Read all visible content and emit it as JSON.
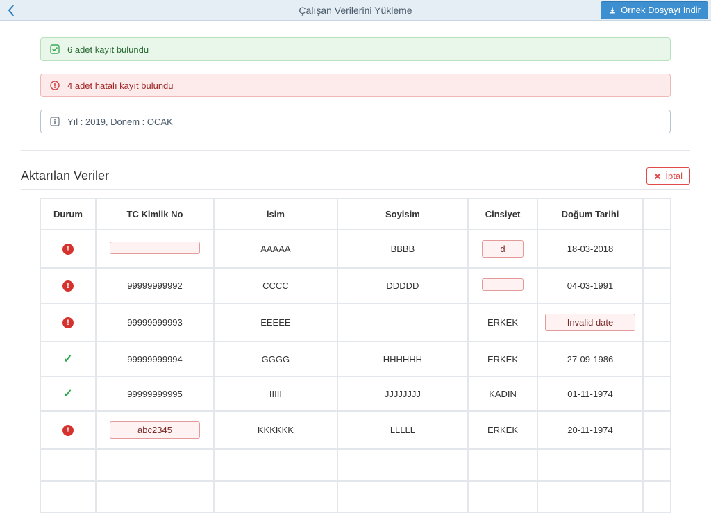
{
  "header": {
    "title": "Çalışan Verilerini Yükleme",
    "download_label": "Örnek Dosyayı İndir"
  },
  "alerts": {
    "success_text": "6 adet kayıt bulundu",
    "error_text": "4 adet hatalı kayıt bulundu",
    "info_text": "Yıl : 2019, Dönem : OCAK"
  },
  "section": {
    "title": "Aktarılan Veriler",
    "cancel_label": "İptal"
  },
  "table": {
    "headers": {
      "status": "Durum",
      "tckn": "TC Kimlik No",
      "name": "İsim",
      "surname": "Soyisim",
      "gender": "Cinsiyet",
      "dob": "Doğum Tarihi"
    },
    "rows": [
      {
        "status": "error",
        "tckn": "",
        "tckn_invalid": true,
        "name": "AAAAA",
        "surname": "BBBB",
        "gender": "d",
        "gender_invalid": true,
        "dob": "18-03-2018",
        "dob_invalid": false
      },
      {
        "status": "error",
        "tckn": "99999999992",
        "tckn_invalid": false,
        "name": "CCCC",
        "surname": "DDDDD",
        "gender": "",
        "gender_invalid": true,
        "dob": "04-03-1991",
        "dob_invalid": false
      },
      {
        "status": "error",
        "tckn": "99999999993",
        "tckn_invalid": false,
        "name": "EEEEE",
        "surname": "",
        "gender": "ERKEK",
        "gender_invalid": false,
        "dob": "Invalid date",
        "dob_invalid": true
      },
      {
        "status": "ok",
        "tckn": "99999999994",
        "tckn_invalid": false,
        "name": "GGGG",
        "surname": "HHHHHH",
        "gender": "ERKEK",
        "gender_invalid": false,
        "dob": "27-09-1986",
        "dob_invalid": false
      },
      {
        "status": "ok",
        "tckn": "99999999995",
        "tckn_invalid": false,
        "name": "IIIII",
        "surname": "JJJJJJJJ",
        "gender": "KADIN",
        "gender_invalid": false,
        "dob": "01-11-1974",
        "dob_invalid": false
      },
      {
        "status": "error",
        "tckn": "abc2345",
        "tckn_invalid": true,
        "name": "KKKKKK",
        "surname": "LLLLL",
        "gender": "ERKEK",
        "gender_invalid": false,
        "dob": "20-11-1974",
        "dob_invalid": false
      }
    ]
  }
}
